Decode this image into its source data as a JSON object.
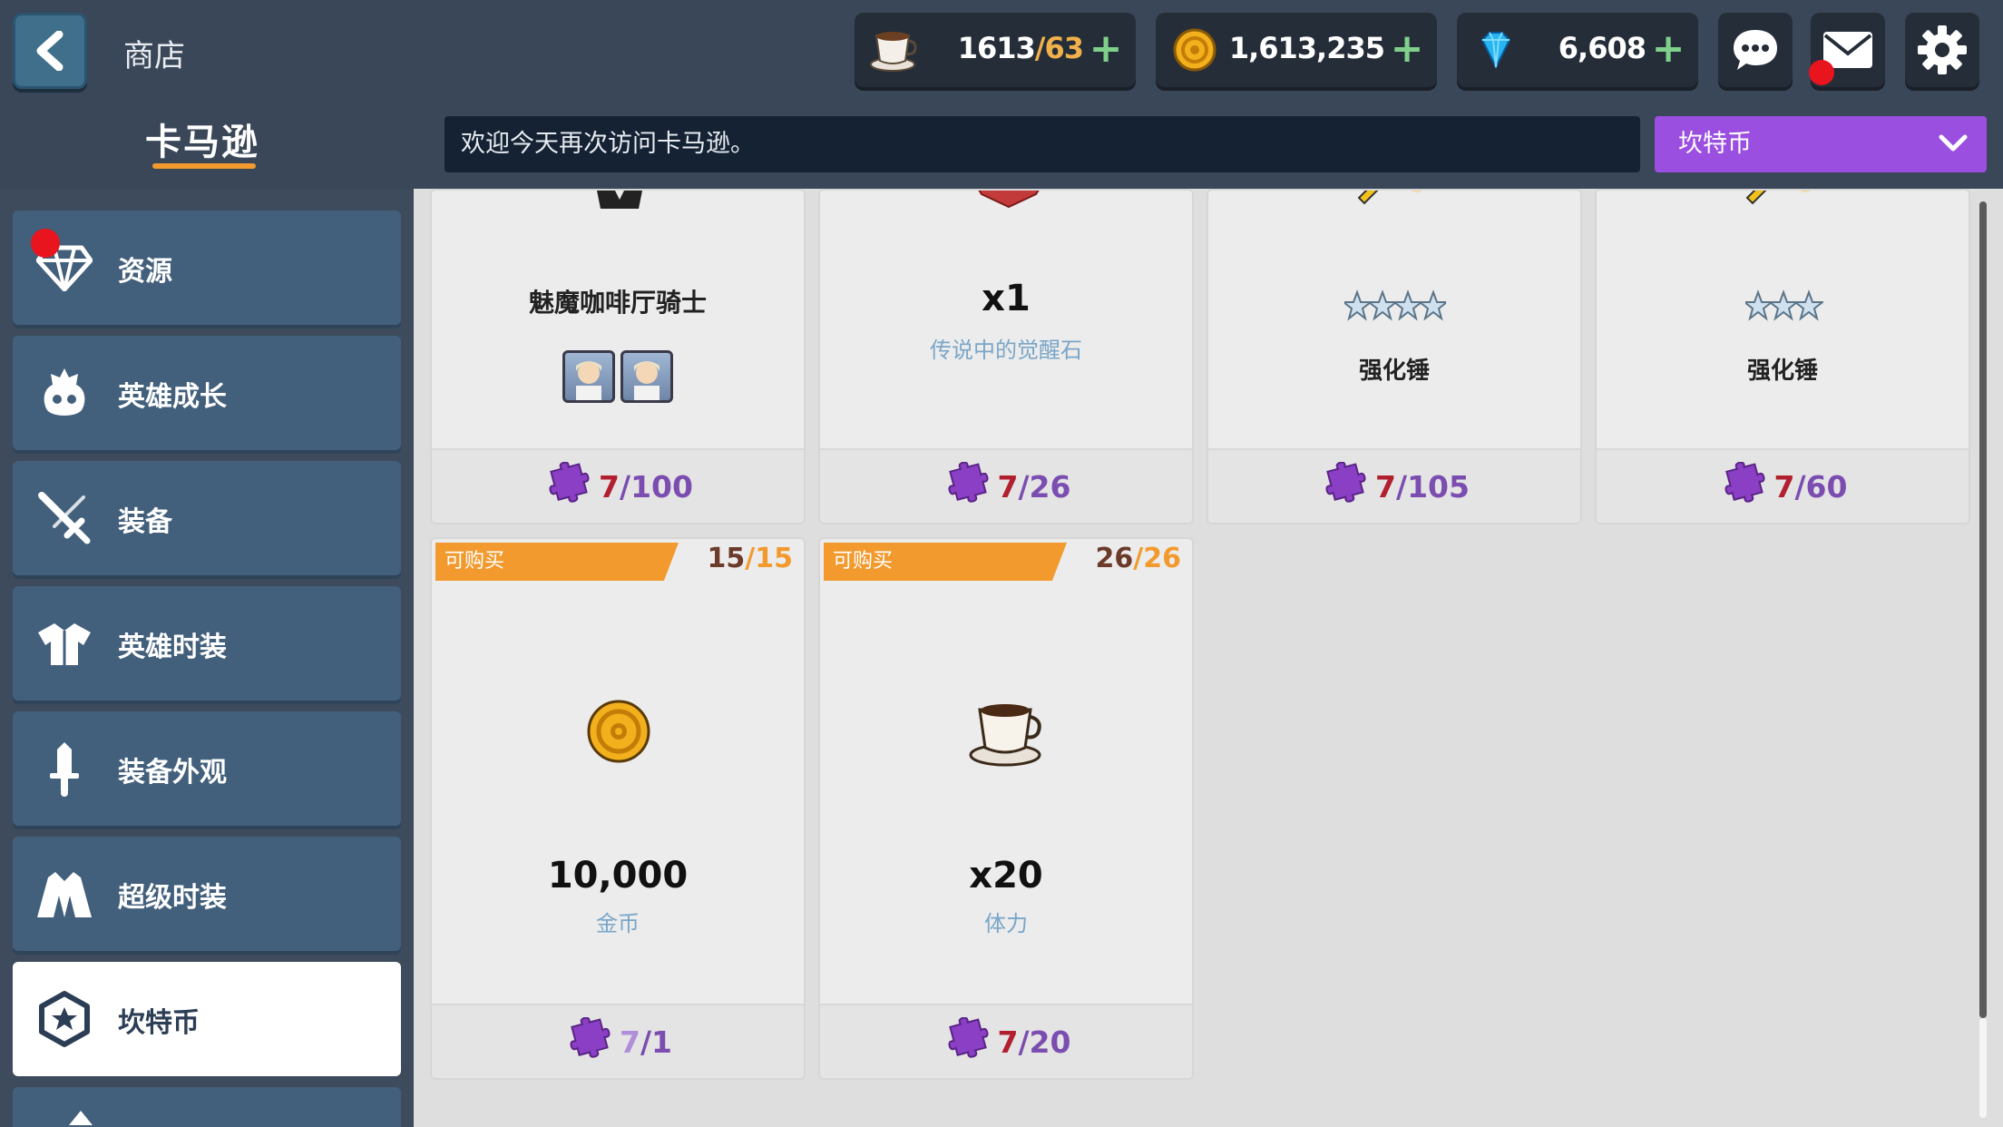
{
  "header": {
    "title": "商店",
    "resources": [
      {
        "name": "stamina",
        "icon": "coffee-cup-icon",
        "value": "1613",
        "max": "/63"
      },
      {
        "name": "gold",
        "icon": "gold-coin-icon",
        "value": "1,613,235",
        "max": ""
      },
      {
        "name": "gems",
        "icon": "gem-icon",
        "value": "6,608",
        "max": ""
      }
    ],
    "plus": "+"
  },
  "store": {
    "name": "卡马逊",
    "welcome": "欢迎今天再次访问卡马逊。",
    "currency_selected": "坎特币"
  },
  "sidebar": {
    "items": [
      {
        "label": "资源",
        "icon": "diamond-icon",
        "badge": true
      },
      {
        "label": "英雄成长",
        "icon": "hero-growth-icon"
      },
      {
        "label": "装备",
        "icon": "sword-icon"
      },
      {
        "label": "英雄时装",
        "icon": "costume-icon"
      },
      {
        "label": "装备外观",
        "icon": "weapon-skin-icon"
      },
      {
        "label": "超级时装",
        "icon": "super-costume-icon"
      },
      {
        "label": "坎特币",
        "icon": "cant-coin-icon",
        "active": true
      }
    ]
  },
  "shop": {
    "row1": [
      {
        "name": "魅魔咖啡厅骑士",
        "price_have": "7",
        "price_cost": "/100"
      },
      {
        "qty": "x1",
        "sub": "传说中的觉醒石",
        "price_have": "7",
        "price_cost": "/26"
      },
      {
        "name": "强化锤",
        "stars": 4,
        "price_have": "7",
        "price_cost": "/105"
      },
      {
        "name": "强化锤",
        "stars": 3,
        "price_have": "7",
        "price_cost": "/60"
      }
    ],
    "row2": [
      {
        "tag": "可购买",
        "count": "15",
        "limit": "/15",
        "qty": "10,000",
        "sub": "金币",
        "price_have": "7",
        "price_cost": "/1"
      },
      {
        "tag": "可购买",
        "count": "26",
        "limit": "/26",
        "qty": "x20",
        "sub": "体力",
        "price_have": "7",
        "price_cost": "/20"
      }
    ]
  },
  "colors": {
    "accent_orange": "#f29a2e",
    "accent_purple": "#9b4fe0",
    "price_red": "#b21f2f",
    "puzzle_purple": "#8a3fc4"
  }
}
